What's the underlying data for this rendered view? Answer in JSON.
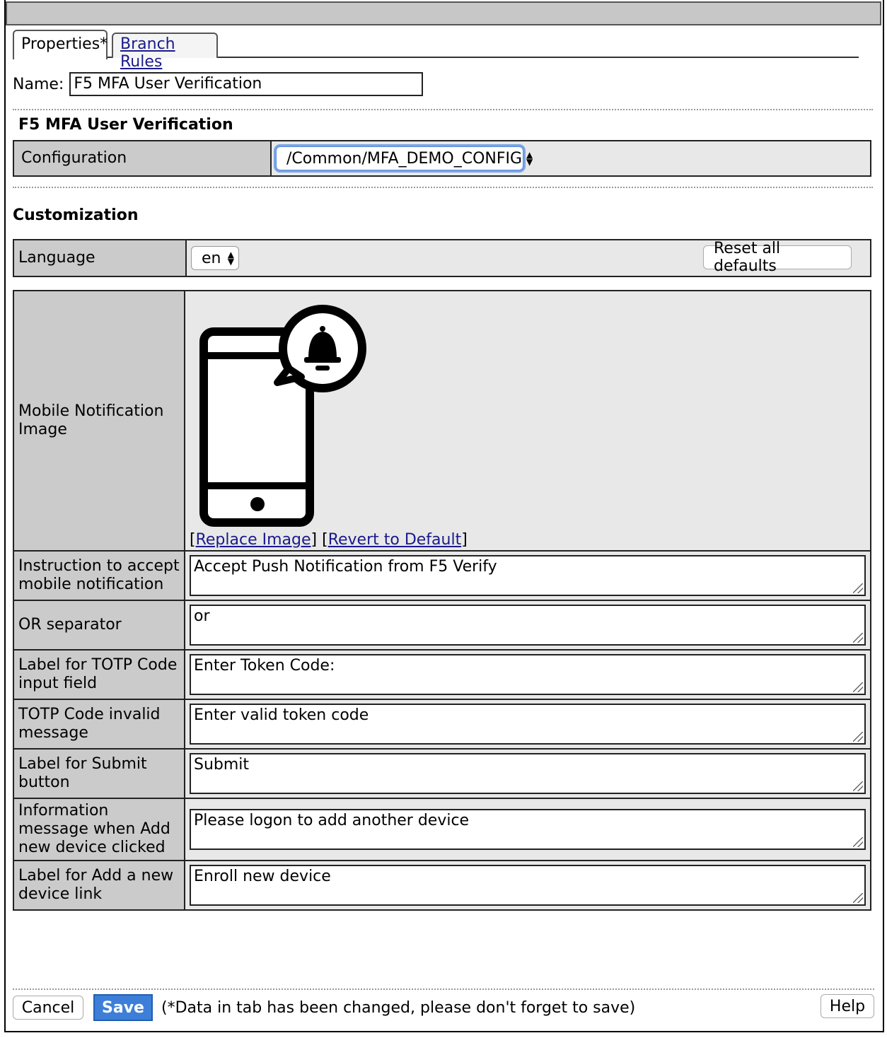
{
  "tabs": [
    {
      "label": "Properties*"
    },
    {
      "label": "Branch Rules"
    }
  ],
  "name_field": {
    "label": "Name:",
    "value": "F5 MFA User Verification"
  },
  "agent_section": {
    "title": "F5 MFA User Verification",
    "configuration": {
      "label": "Configuration",
      "value": "/Common/MFA_DEMO_CONFIG"
    }
  },
  "customization": {
    "title": "Customization",
    "language": {
      "label": "Language",
      "value": "en"
    },
    "reset_label": "Reset all defaults",
    "image_row": {
      "label": "Mobile Notification Image",
      "replace_link": "Replace Image",
      "revert_link": "Revert to Default"
    },
    "rows": [
      {
        "label": "Instruction to accept mobile notification",
        "value": "Accept Push Notification from F5 Verify"
      },
      {
        "label": "OR separator",
        "value": "or"
      },
      {
        "label": "Label for TOTP Code input field",
        "value": "Enter Token Code:"
      },
      {
        "label": "TOTP Code invalid message",
        "value": "Enter valid token code"
      },
      {
        "label": "Label for Submit button",
        "value": "Submit"
      },
      {
        "label": "Information message when Add new device clicked",
        "value": "Please logon to add another device"
      },
      {
        "label": "Label for Add a new device link",
        "value": "Enroll new device"
      }
    ]
  },
  "footer": {
    "cancel_label": "Cancel",
    "save_label": "Save",
    "message": "(*Data in tab has been changed, please don't forget to save)",
    "help_label": "Help"
  },
  "colors": {
    "label_bg": "#cbcbcb",
    "value_bg": "#e8e8e8",
    "save_blue": "#3d7fd8",
    "link": "#1a1a8c"
  }
}
